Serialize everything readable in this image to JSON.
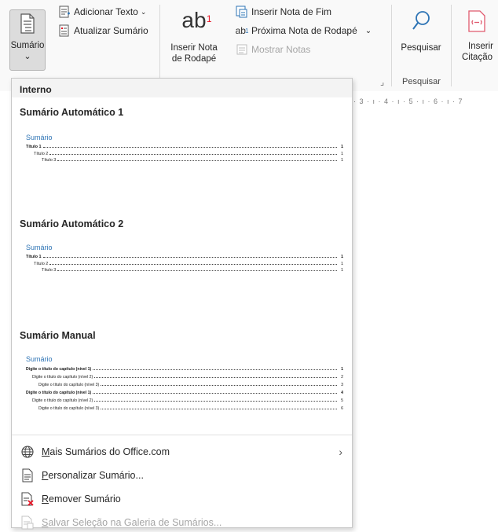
{
  "ribbon": {
    "sumario_label": "Sumário",
    "adicionar_texto": "Adicionar Texto",
    "atualizar_sumario": "Atualizar Sumário",
    "inserir_nota_rodape_line1": "Inserir Nota",
    "inserir_nota_rodape_line2": "de Rodapé",
    "inserir_nota_fim": "Inserir Nota de Fim",
    "proxima_nota": "Próxima Nota de Rodapé",
    "mostrar_notas": "Mostrar Notas",
    "pesquisar_button": "Pesquisar",
    "pesquisar_group": "Pesquisar",
    "inserir_citacao_line1": "Inserir",
    "inserir_citacao_line2": "Citação",
    "ab_glyph": "ab",
    "ab_superscript": "1",
    "ab_small": "ab",
    "ab_small_sub": "1",
    "dropdown_caret": "⌄",
    "dialog_launcher": "⌟"
  },
  "ruler_text": "· 3 · ı · 4 · ı · 5 · ı · 6 · ı · 7",
  "dropdown": {
    "header": "Interno",
    "galleries": [
      {
        "title": "Sumário Automático 1",
        "toc_heading": "Sumário",
        "entries": [
          {
            "text": "Título 1",
            "page": "1",
            "level": 1
          },
          {
            "text": "Título 2",
            "page": "1",
            "level": 2
          },
          {
            "text": "Título 3",
            "page": "1",
            "level": 3
          }
        ]
      },
      {
        "title": "Sumário Automático 2",
        "toc_heading": "Sumário",
        "entries": [
          {
            "text": "Título 1",
            "page": "1",
            "level": 1
          },
          {
            "text": "Título 2",
            "page": "1",
            "level": 2
          },
          {
            "text": "Título 3",
            "page": "1",
            "level": 3
          }
        ]
      },
      {
        "title": "Sumário Manual",
        "toc_heading": "Sumário",
        "entries": [
          {
            "text": "Digite o título do capítulo (nível 1)",
            "page": "1",
            "level": 1
          },
          {
            "text": "Digite o título do capítulo (nível 2)",
            "page": "2",
            "level": 2
          },
          {
            "text": "Digite o título do capítulo (nível 3)",
            "page": "3",
            "level": 3
          },
          {
            "text": "Digite o título do capítulo (nível 1)",
            "page": "4",
            "level": 1
          },
          {
            "text": "Digite o título do capítulo (nível 2)",
            "page": "5",
            "level": 2
          },
          {
            "text": "Digite o título do capítulo (nível 3)",
            "page": "6",
            "level": 3
          }
        ]
      }
    ],
    "menu": {
      "mais_sumarios": {
        "u": "M",
        "rest": "ais Sumários do Office.com",
        "chevron": "›"
      },
      "personalizar": {
        "u": "P",
        "rest": "ersonalizar Sumário..."
      },
      "remover": {
        "u": "R",
        "rest": "emover Sumário"
      },
      "salvar": {
        "u": "S",
        "rest": "alvar Seleção na Galeria de Sumários..."
      }
    }
  },
  "colors": {
    "accent_blue": "#2e74b5",
    "disabled_gray": "#a6a6a6",
    "ribbon_bg": "#f9f9f9"
  }
}
